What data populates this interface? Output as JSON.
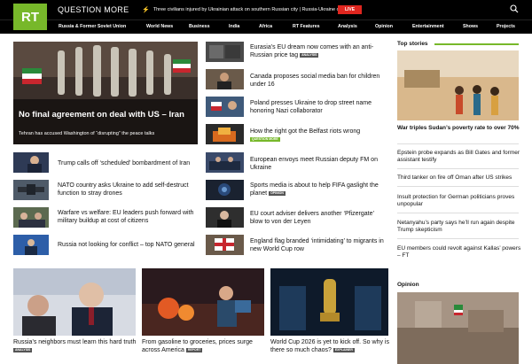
{
  "brand": {
    "logo": "RT",
    "question": "QUESTION MORE"
  },
  "ticker": {
    "text": "Three civilians injured by Ukrainian attack on southern Russian city | Russia-Ukraine conflict",
    "live": "LIVE"
  },
  "nav": [
    "Russia & Former Soviet Union",
    "World News",
    "Business",
    "India",
    "Africa",
    "RT Features",
    "Analysis",
    "Opinion",
    "Entertainment",
    "Shows",
    "Projects"
  ],
  "hero": {
    "title": "No final agreement on deal with US – Iran",
    "subtitle": "Tehran has accused Washington of “disrupting” the peace talks"
  },
  "left_list": [
    {
      "title": "Trump calls off ‘scheduled’ bombardment of Iran",
      "tag": ""
    },
    {
      "title": "NATO country asks Ukraine to add self-destruct function to stray drones",
      "tag": ""
    },
    {
      "title": "Warfare vs welfare: EU leaders push forward with military buildup at cost of citizens",
      "tag": ""
    },
    {
      "title": "Russia not looking for conflict – top NATO general",
      "tag": ""
    }
  ],
  "middle_list": [
    {
      "title": "Eurasia’s EU dream now comes with an anti-Russian price tag",
      "tag": "ANALYSIS"
    },
    {
      "title": "Canada proposes social media ban for children under 16",
      "tag": ""
    },
    {
      "title": "Poland presses Ukraine to drop street name honoring Nazi collaborator",
      "tag": ""
    },
    {
      "title": "How the right got the Belfast riots wrong",
      "tag": "QUESTION MORE"
    },
    {
      "title": "European envoys meet Russian deputy FM on Ukraine",
      "tag": ""
    },
    {
      "title": "Sports media is about to help FIFA gaslight the planet",
      "tag": "OPINION"
    },
    {
      "title": "EU court adviser delivers another ‘Pfizergate’ blow to von der Leyen",
      "tag": ""
    },
    {
      "title": "England flag branded ‘intimidating’ to migrants in new World Cup row",
      "tag": ""
    }
  ],
  "top_stories": {
    "heading": "Top stories",
    "lead": "War triples Sudan’s poverty rate to over 70%",
    "items": [
      "Epstein probe expands as Bill Gates and former assistant testify",
      "Third tanker on fire off Oman after US strikes",
      "Insult protection for German politicians proves unpopular",
      "Netanyahu’s party says he’ll run again despite Trump skepticism",
      "EU members could revolt against Kallas’ powers – FT"
    ]
  },
  "opinion": {
    "heading": "Opinion"
  },
  "bottom": [
    {
      "title": "Russia’s neighbors must learn this hard truth",
      "tag": "ANALYSIS"
    },
    {
      "title": "From gasoline to groceries, prices surge across America",
      "tag": "REPORT"
    },
    {
      "title": "World Cup 2026 is yet to kick off. So why is there so much chaos?",
      "tag": "EXPLAINER"
    }
  ],
  "colors": {
    "accent": "#77b82a",
    "live": "#e0261f",
    "bar": "#000000"
  }
}
